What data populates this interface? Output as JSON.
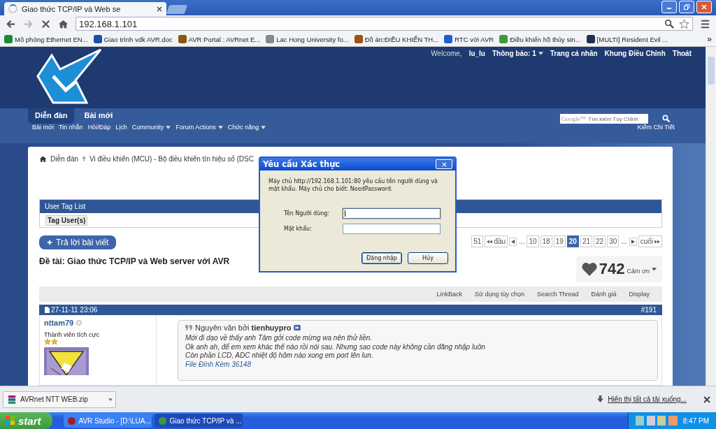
{
  "browser": {
    "tab": {
      "title": "Giao thức TCP/IP và Web se",
      "loading": true
    },
    "address": "192.168.1.101",
    "bookmarks": [
      {
        "label": "Mô phỏng Ethernet EN..."
      },
      {
        "label": "Giao trình vdk AVR.doc"
      },
      {
        "label": "AVR Portal : AVRnet E..."
      },
      {
        "label": "Lac Hong University fo..."
      },
      {
        "label": "Đồ án:ĐIỀU KHIỂN TH..."
      },
      {
        "label": "RTC với AVR"
      },
      {
        "label": "Điều khiển hồ thủy sin..."
      },
      {
        "label": "[MULTI] Resident Evil ..."
      }
    ],
    "more": "»"
  },
  "forum": {
    "user_bar": {
      "welcome": "Welcome,",
      "user": "lu_lu",
      "notices": "Thông báo: 1",
      "links": [
        "Trang cá nhân",
        "Khung Điều Chỉnh",
        "Thoát"
      ]
    },
    "tabs": [
      {
        "label": "Diễn đàn",
        "selected": true
      },
      {
        "label": "Bài mới",
        "selected": false
      }
    ],
    "subnav": [
      {
        "label": "Bài mới",
        "dropdown": false
      },
      {
        "label": "Tin nhắn",
        "dropdown": false
      },
      {
        "label": "Hỏi/Đáp",
        "dropdown": false
      },
      {
        "label": "Lịch",
        "dropdown": false
      },
      {
        "label": "Community",
        "dropdown": true
      },
      {
        "label": "Forum Actions",
        "dropdown": true
      },
      {
        "label": "Chức năng",
        "dropdown": true
      }
    ],
    "search": {
      "logo": "Google™",
      "placeholder": "Tìm kiếm Tùy Chỉnh",
      "advanced": "Kiếm Chi Tiết"
    },
    "breadcrumb": [
      "Diễn đàn",
      "Vi điều khiển (MCU) - Bộ điều khiển tín hiệu số (DSC"
    ],
    "user_tag_list": {
      "title": "User Tag List",
      "button": "Tag User(s)"
    },
    "reply_button": "Trả lời bài viết",
    "thread_title": "Đề tài: Giao thức TCP/IP và Web server với AVR",
    "pagination": [
      {
        "kind": "page",
        "label": "51",
        "selected": false
      },
      {
        "kind": "first",
        "label": "đầu",
        "selected": false
      },
      {
        "kind": "prev",
        "selected": false
      },
      {
        "kind": "gap",
        "label": "...",
        "selected": false
      },
      {
        "kind": "page",
        "label": "10",
        "selected": false
      },
      {
        "kind": "page",
        "label": "18",
        "selected": false
      },
      {
        "kind": "page",
        "label": "19",
        "selected": false
      },
      {
        "kind": "page",
        "label": "20",
        "selected": true
      },
      {
        "kind": "page",
        "label": "21",
        "selected": false
      },
      {
        "kind": "page",
        "label": "22",
        "selected": false
      },
      {
        "kind": "page",
        "label": "30",
        "selected": false
      },
      {
        "kind": "gap",
        "label": "...",
        "selected": false
      },
      {
        "kind": "next",
        "selected": false
      },
      {
        "kind": "last",
        "label": "cuối",
        "selected": false
      }
    ],
    "thanks": {
      "count": "742",
      "label": "Cảm ơn"
    },
    "thread_tools": [
      "LinkBack",
      "Sử dụng tùy chọn",
      "Search Thread",
      "Đánh giá",
      "Display"
    ],
    "post": {
      "date": "27-11-11 23:06",
      "number": "#191",
      "author": "nttam79",
      "online": false,
      "rank": "Thành viên tích cực",
      "quote": {
        "header": "Nguyên văn bởi **tienhuypro**",
        "lines": [
          "Mới đi dạo về thấy anh Tâm gởi code mừng wa nên thử liền.",
          "Ok anh ah, để em xem khác thế nào rồi nói sau. Nhưng sao code này không cần đăng nhập luôn",
          "Còn phần LCD, ADC nhiệt độ hôm nào xong em port lên lun."
        ],
        "attachment": "File Đính Kèm 36148"
      }
    }
  },
  "dialog": {
    "title": "Yêu cầu Xác thực",
    "message": "Máy chủ http://192.168.1.101:80 yêu cầu tên người dùng và mật khẩu. Máy chủ cho biết: NeedPassword.",
    "fields": [
      {
        "label": "Tên Người dùng:",
        "focused": true
      },
      {
        "label": "Mật khẩu:",
        "focused": false
      }
    ],
    "buttons": [
      "Đăng nhập",
      "Hủy"
    ]
  },
  "downloads": {
    "file": "AVRnet NTT WEB.zip",
    "show_all": "Hiển thị tất cả tải xuống..."
  },
  "taskbar": {
    "start": "start",
    "tasks": [
      {
        "label": "AVR Studio - [D:\\LUA...",
        "selected": false
      },
      {
        "label": "Giao thức TCP/IP và ...",
        "selected": true
      }
    ],
    "clock": "8:47 PM"
  }
}
